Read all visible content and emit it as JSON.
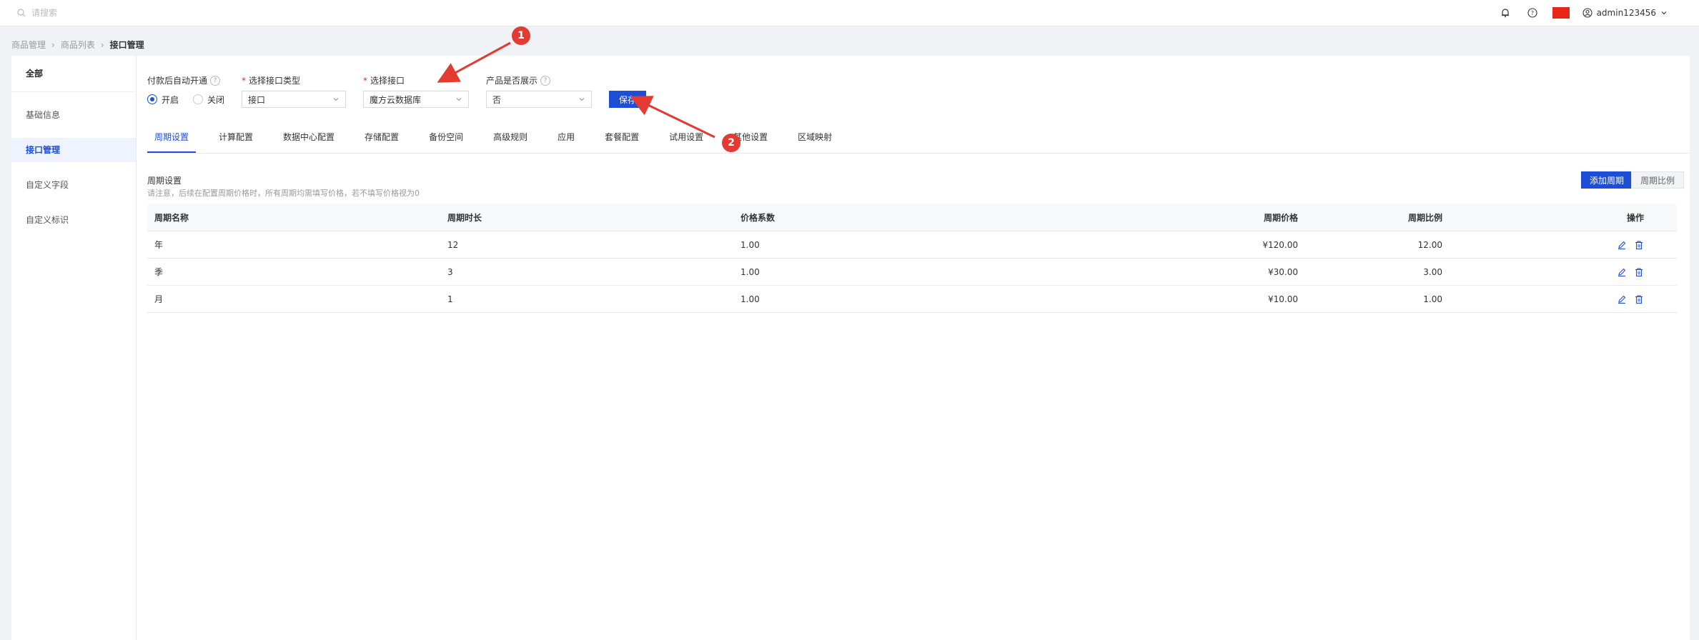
{
  "topbar": {
    "search_placeholder": "请搜索",
    "username": "admin123456"
  },
  "breadcrumb": [
    "商品管理",
    "商品列表",
    "接口管理"
  ],
  "sidebar": {
    "header": "全部",
    "items": [
      {
        "label": "基础信息",
        "active": false
      },
      {
        "label": "接口管理",
        "active": true
      },
      {
        "label": "自定义字段",
        "active": false
      },
      {
        "label": "自定义标识",
        "active": false
      }
    ]
  },
  "form": {
    "auto_open_label": "付款后自动开通",
    "radio_on": "开启",
    "radio_off": "关闭",
    "selected": "开启",
    "type_label": "选择接口类型",
    "type_value": "接口",
    "iface_label": "选择接口",
    "iface_value": "魔方云数据库",
    "show_label": "产品是否展示",
    "show_value": "否",
    "save": "保存"
  },
  "tabs": [
    "周期设置",
    "计算配置",
    "数据中心配置",
    "存储配置",
    "备份空间",
    "高级规则",
    "应用",
    "套餐配置",
    "试用设置",
    "其他设置",
    "区域映射"
  ],
  "active_tab": "周期设置",
  "section": {
    "title": "周期设置",
    "subtitle": "请注意，后续在配置周期价格时，所有周期均需填写价格，若不填写价格视为0",
    "add_button": "添加周期",
    "ratio_button": "周期比例"
  },
  "table": {
    "headers": [
      "周期名称",
      "周期时长",
      "价格系数",
      "周期价格",
      "周期比例",
      "操作"
    ],
    "rows": [
      [
        "年",
        "12",
        "1.00",
        "¥120.00",
        "12.00"
      ],
      [
        "季",
        "3",
        "1.00",
        "¥30.00",
        "3.00"
      ],
      [
        "月",
        "1",
        "1.00",
        "¥10.00",
        "1.00"
      ]
    ]
  },
  "annotations": [
    "1",
    "2"
  ],
  "colors": {
    "primary": "#1c4fd6",
    "annotation": "#e33a32",
    "flag": "#e8271b"
  }
}
